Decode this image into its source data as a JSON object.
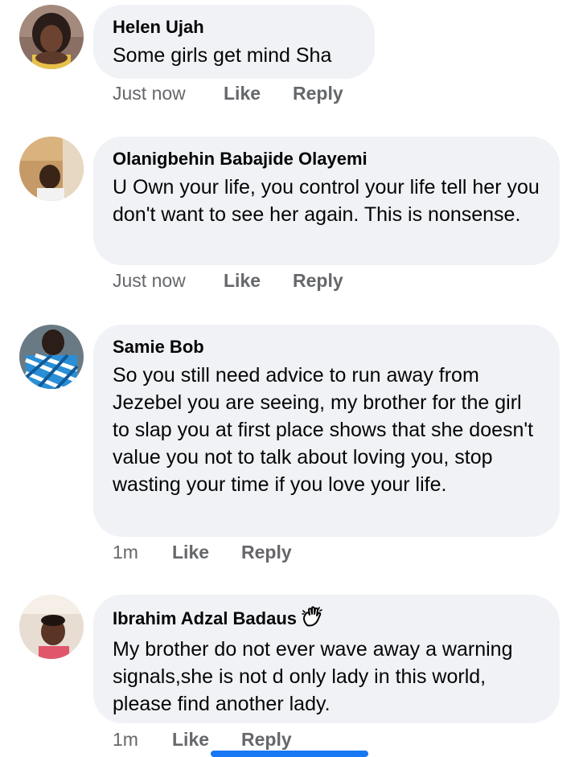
{
  "comments": [
    {
      "author": "Helen Ujah",
      "text": "Some girls get mind Sha",
      "time": "Just now",
      "like": "Like",
      "reply": "Reply"
    },
    {
      "author": "Olanigbehin Babajide Olayemi",
      "text": "U Own your life,  you control your life tell her you don't want to see her again. This is nonsense.",
      "time": "Just now",
      "like": "Like",
      "reply": "Reply"
    },
    {
      "author": "Samie Bob",
      "text": "So you still need advice to run away from Jezebel you are seeing, my brother for the girl to slap you at first place shows that she doesn't value you not to talk about loving you, stop wasting your time if you love your life.",
      "time": "1m",
      "like": "Like",
      "reply": "Reply"
    },
    {
      "author": "Ibrahim Adzal Badaus",
      "badge_icon": "waving-hand-icon",
      "text": "My brother do not ever wave away a warning signals,she is not d only lady in this world, please find another lady.",
      "time": "1m",
      "like": "Like",
      "reply": "Reply"
    }
  ],
  "colors": {
    "bubble": "#f0f2f5",
    "text": "#050505",
    "secondary": "#65676b",
    "accent": "#1877f2"
  }
}
